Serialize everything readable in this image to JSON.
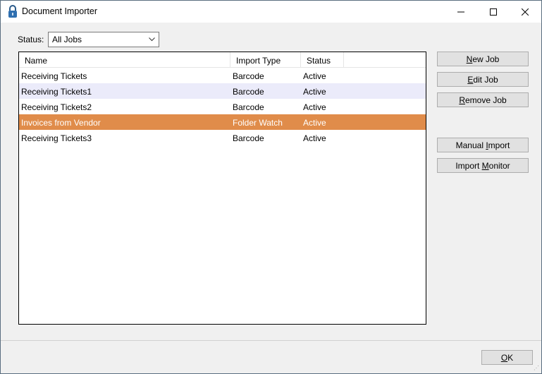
{
  "window": {
    "title": "Document Importer",
    "icon": "lock-icon"
  },
  "filter": {
    "label": "Status:",
    "value": "All Jobs"
  },
  "list": {
    "columns": [
      "Name",
      "Import Type",
      "Status"
    ],
    "rows": [
      {
        "name": "Receiving Tickets",
        "type": "Barcode",
        "status": "Active"
      },
      {
        "name": "Receiving Tickets1",
        "type": "Barcode",
        "status": "Active"
      },
      {
        "name": "Receiving Tickets2",
        "type": "Barcode",
        "status": "Active"
      },
      {
        "name": "Invoices from Vendor",
        "type": "Folder Watch",
        "status": "Active"
      },
      {
        "name": "Receiving Tickets3",
        "type": "Barcode",
        "status": "Active"
      }
    ],
    "selected_index": 3,
    "selected_color": "#e08c4a",
    "alt_row_color": "#ebebfa"
  },
  "buttons": {
    "new_job": {
      "pre": "",
      "key": "N",
      "post": "ew Job"
    },
    "edit_job": {
      "pre": "",
      "key": "E",
      "post": "dit Job"
    },
    "remove_job": {
      "pre": "",
      "key": "R",
      "post": "emove Job"
    },
    "manual_import": {
      "pre": "Manual ",
      "key": "I",
      "post": "mport"
    },
    "import_monitor": {
      "pre": "Import ",
      "key": "M",
      "post": "onitor"
    },
    "ok": {
      "pre": "",
      "key": "O",
      "post": "K"
    }
  }
}
